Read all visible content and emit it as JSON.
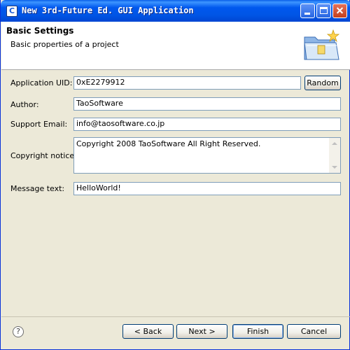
{
  "window": {
    "title": "New 3rd-Future Ed. GUI Application",
    "icon": "app-icon",
    "controls": [
      "minimize-icon",
      "maximize-icon",
      "close-icon"
    ]
  },
  "header": {
    "title": "Basic Settings",
    "description": "Basic properties of a project",
    "icon": "folder-wizard-icon"
  },
  "form": {
    "application_uid": {
      "label": "Application UID:",
      "value": "0xE2279912"
    },
    "random_button": "Random",
    "author": {
      "label": "Author:",
      "value": "TaoSoftware"
    },
    "support_email": {
      "label": "Support Email:",
      "value": "info@taosoftware.co.jp"
    },
    "copyright": {
      "label": "Copyright notice:",
      "value": "Copyright 2008 TaoSoftware All Right Reserved."
    },
    "message_text": {
      "label": "Message text:",
      "value": "HelloWorld!"
    }
  },
  "footer": {
    "help_icon": "?",
    "back_label": "< Back",
    "back_mnemonic": "B",
    "next_label": "Next >",
    "next_mnemonic": "N",
    "finish_label": "Finish",
    "finish_mnemonic": "F",
    "cancel_label": "Cancel"
  },
  "colors": {
    "titlebar": "#0055e5",
    "dialog_bg": "#ece9d8",
    "field_border": "#7f9db9",
    "button_border": "#003c74"
  }
}
